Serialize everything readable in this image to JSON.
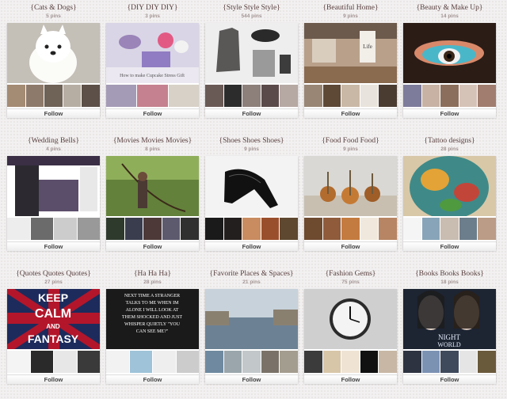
{
  "boards": [
    {
      "title": "{Cats & Dogs}",
      "pins": "5 pins",
      "follow": "Follow",
      "cover_color": "#c9c4bc",
      "thumbs": [
        "#a48b74",
        "#8e7a6b",
        "#6f6256",
        "#b7aea3",
        "#5c5048"
      ]
    },
    {
      "title": "{DIY DIY DIY}",
      "pins": "3 pins",
      "follow": "Follow",
      "cover_color": "#d9d5e6",
      "cover_caption": "How to make Cupcake Stress Gift",
      "thumbs": [
        "#a49bb6",
        "#c5818f",
        "#d7d1c7"
      ]
    },
    {
      "title": "{Style Style Style}",
      "pins": "544 pins",
      "follow": "Follow",
      "cover_color": "#eeeeee",
      "thumbs": [
        "#6a5a56",
        "#2d2c2c",
        "#8d7f7a",
        "#5b4a4a",
        "#b6a8a3"
      ]
    },
    {
      "title": "{Beautiful Home}",
      "pins": "9 pins",
      "follow": "Follow",
      "cover_color": "#b8a08a",
      "cover_caption": "Life",
      "thumbs": [
        "#9a8675",
        "#5e4937",
        "#c9b8a5",
        "#e8e3dc",
        "#4a3c31"
      ]
    },
    {
      "title": "{Beauty & Make Up}",
      "pins": "14 pins",
      "follow": "Follow",
      "cover_color": "#2b1c16",
      "thumbs": [
        "#7e7c9b",
        "#c7b2a4",
        "#8c6e5c",
        "#d6c3b8",
        "#a07d6e"
      ]
    },
    {
      "title": "{Wedding Bells}",
      "pins": "4 pins",
      "follow": "Follow",
      "cover_color": "#4a4353",
      "thumbs": [
        "#ededed",
        "#6b6b6b",
        "#cccccc",
        "#999999"
      ]
    },
    {
      "title": "{Movies Movies Movies}",
      "pins": "8 pins",
      "follow": "Follow",
      "cover_color": "#63813a",
      "thumbs": [
        "#2e3a2c",
        "#3a3d4e",
        "#4d3a38",
        "#5d5a6e",
        "#303030"
      ]
    },
    {
      "title": "{Shoes Shoes Shoes}",
      "pins": "9 pins",
      "follow": "Follow",
      "cover_color": "#f3f3f3",
      "thumbs": [
        "#1a1a1a",
        "#231f1f",
        "#c98c60",
        "#9a4f2c",
        "#5e4830"
      ]
    },
    {
      "title": "{Food Food Food}",
      "pins": "9 pins",
      "follow": "Follow",
      "cover_color": "#dad8d4",
      "thumbs": [
        "#6e4a2f",
        "#8f5b3b",
        "#c47b3f",
        "#f0e8dc",
        "#b78563"
      ]
    },
    {
      "title": "{Tattoo designs}",
      "pins": "28 pins",
      "follow": "Follow",
      "cover_color": "#3e6f6d",
      "thumbs": [
        "#f5f5f5",
        "#88a4b8",
        "#c9bcb0",
        "#6c7d8b",
        "#bb9c86"
      ]
    },
    {
      "title": "{Quotes Quotes Quotes}",
      "pins": "27 pins",
      "follow": "Follow",
      "cover_color": "#1d2b5c",
      "cover_caption": "KEEP|CALM|AND|FANTASY",
      "thumbs": [
        "#f4f4f4",
        "#2a2a2a",
        "#e7e7e7",
        "#3a3a3a"
      ]
    },
    {
      "title": "{Ha Ha Ha}",
      "pins": "28 pins",
      "follow": "Follow",
      "cover_color": "#1a1a1a",
      "cover_caption": "NEXT TIME A STRANGER TALKS TO ME WHEN IM ALONE I WILL LOOK AT THEM SHOCKED AND JUST WHISPER QUIETLY \"YOU CAN SEE ME?\"",
      "thumbs": [
        "#f2f2f2",
        "#9fc3d8",
        "#eeeeee",
        "#cccccc"
      ]
    },
    {
      "title": "{Favorite Places & Spaces}",
      "pins": "21 pins",
      "follow": "Follow",
      "cover_color": "#8aa0b2",
      "thumbs": [
        "#6f8aa0",
        "#9aa6ab",
        "#c2c8ca",
        "#7a7268",
        "#a39d8f"
      ]
    },
    {
      "title": "{Fashion Gems}",
      "pins": "75 pins",
      "follow": "Follow",
      "cover_color": "#cfcfcf",
      "thumbs": [
        "#3b3b3b",
        "#d8c6a8",
        "#efe3d4",
        "#111111",
        "#c7b7a4"
      ]
    },
    {
      "title": "{Books Books Books}",
      "pins": "18 pins",
      "follow": "Follow",
      "cover_color": "#1d2432",
      "cover_caption": "NIGHT|WORLD",
      "thumbs": [
        "#2d3340",
        "#7b92b3",
        "#3f4a5c",
        "#e5e5e5",
        "#6a5a3c"
      ]
    }
  ]
}
